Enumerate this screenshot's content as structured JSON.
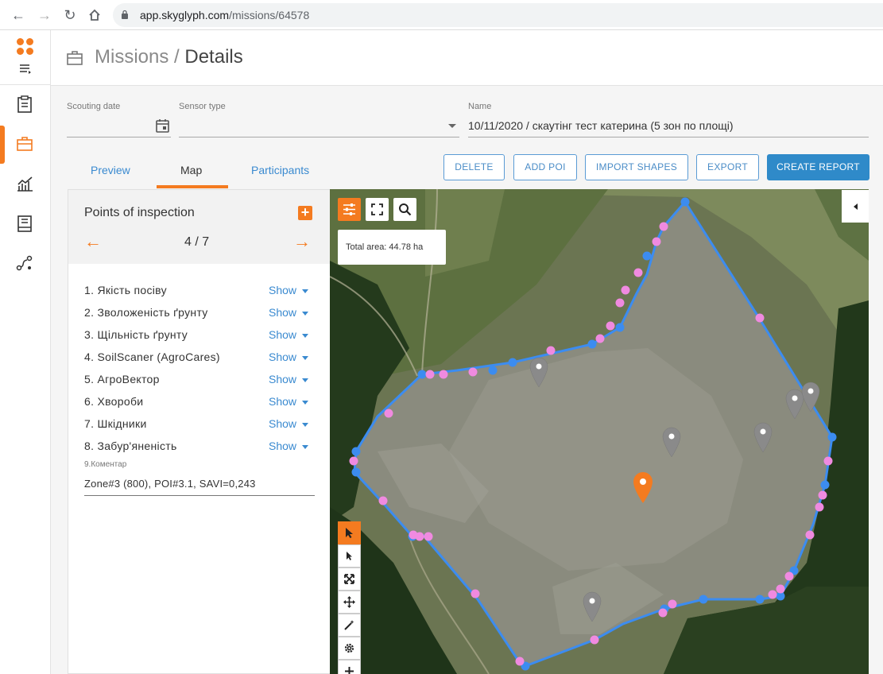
{
  "browser": {
    "url_host": "app.skyglyph.com",
    "url_path": "/missions/64578"
  },
  "header": {
    "section": "Missions",
    "separator": " / ",
    "page": "Details"
  },
  "form": {
    "scouting_date_label": "Scouting date",
    "scouting_date_value": "",
    "sensor_type_label": "Sensor type",
    "sensor_type_value": "",
    "name_label": "Name",
    "name_value": "10/11/2020 / скаутінг тест катерина (5 зон по площі)"
  },
  "tabs": [
    {
      "label": "Preview",
      "active": false
    },
    {
      "label": "Map",
      "active": true
    },
    {
      "label": "Participants",
      "active": false
    }
  ],
  "actions": {
    "delete": "DELETE",
    "add_poi": "ADD POI",
    "import_shapes": "IMPORT SHAPES",
    "export": "EXPORT",
    "create_report": "CREATE REPORT"
  },
  "poi_panel": {
    "title": "Points of inspection",
    "add_symbol": "+",
    "counter": "4 / 7",
    "prev_symbol": "←",
    "next_symbol": "→",
    "show_label": "Show",
    "items": [
      "1. Якість посіву",
      "2. Зволоженість ґрунту",
      "3. Щільність ґрунту",
      "4. SoilScaner (AgroCares)",
      "5. АгроВектор",
      "6. Хвороби",
      "7. Шкідники",
      "8. Забур'яненість"
    ],
    "comment_label": "9.Коментар",
    "comment_value": "Zone#3 (800), POI#3.1, SAVI=0,243"
  },
  "map": {
    "total_area_label": "Total area: 44.78 ha",
    "boundary_color": "#3c8cf0",
    "vertex_color": "#f08ae0",
    "active_marker_color": "#f47b20",
    "inactive_marker_color": "#8a8a8a",
    "tools": [
      "settings-sliders-icon",
      "fullscreen-icon",
      "search-icon"
    ],
    "draw_tools": [
      "select-arrow-icon",
      "direct-select-icon",
      "scale-icon",
      "move-icon",
      "magic-wand-icon",
      "settings-gear-icon",
      "plus-icon"
    ]
  },
  "colors": {
    "accent": "#f47b20",
    "link": "#3a8ad0",
    "primary_button": "#2f8ac9"
  }
}
